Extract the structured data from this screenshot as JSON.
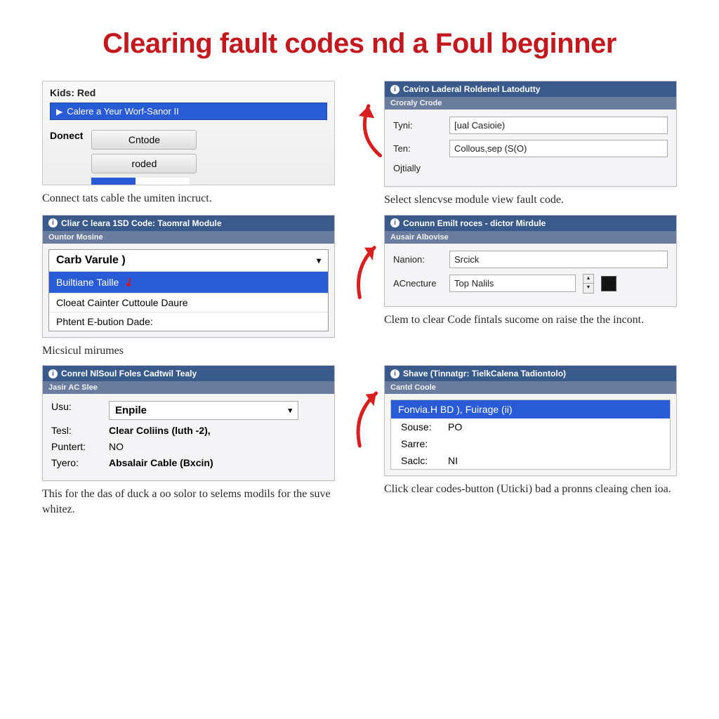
{
  "title": "Clearing fault codes nd a Foul beginner",
  "steps": {
    "s1": {
      "label": "Kids: Red",
      "highlight_text": "Calere a Yeur Worf-Sanor II",
      "donect": "Donect",
      "btn1": "Cntode",
      "btn2": "roded",
      "caption": "Connect tats cable the umiten incruct."
    },
    "s2": {
      "header": "Caviro Laderal Roldenel Latodutty",
      "sub": "Croraly Crode",
      "row1_label": "Tyni:",
      "row1_value": "[ual Casioie)",
      "row2_label": "Ten:",
      "row2_value": "Collous,sep (S(O)",
      "row3_label": "Ojtially",
      "caption": "Select slencvse module view fault code."
    },
    "s3": {
      "header": "Cliar C leara 1SD Code: Taomral Module",
      "sub": "Ountor Mosine",
      "dd_head": "Carb Varule )",
      "item_sel": "Builtiane  Taille",
      "item2": "Cloeat Cainter Cuttoule Daure",
      "item3": "Phtent E-bution Dade:",
      "caption": "Micsicul mirumes"
    },
    "s4": {
      "header": "Conunn Emilt roces - dictor Mirdule",
      "sub": "Ausair Albovise",
      "row1_label": "Nanion:",
      "row1_value": "Srcick",
      "row2_label": "ACnecture",
      "row2_value": "Top Nalils",
      "caption": "Clem to clear Code fintals sucome on raise the the incont."
    },
    "s5": {
      "header": "Conrel NlSoul Foles  Cadtwil Tealy",
      "sub": "Jasir AC Slee",
      "r1_k": "Usu:",
      "r1_v": "Enpile",
      "r2_k": "Tesl:",
      "r2_v": "Clear Coliins (luth -2),",
      "r3_k": "Puntert:",
      "r3_v": "NO",
      "r4_k": "Tyero:",
      "r4_v": "Absalair Cable (Bxcin)",
      "caption": "This for the das of duck a oo solor to selems modils for the suve whitez."
    },
    "s6": {
      "header": "Shave (Tinnatgr: TielkCalena Tadiontolo)",
      "sub": "Cantd Coole",
      "hl": "Fonvia.H BD ), Fuirage (ii)",
      "r1_k": "Souse:",
      "r1_v": "PO",
      "r2_k": "Sarre:",
      "r2_v": "",
      "r3_k": "Saclc:",
      "r3_v": "NI",
      "caption": "Click clear codes-button (Uticki) bad a pronns cleaing chen ioa."
    }
  }
}
